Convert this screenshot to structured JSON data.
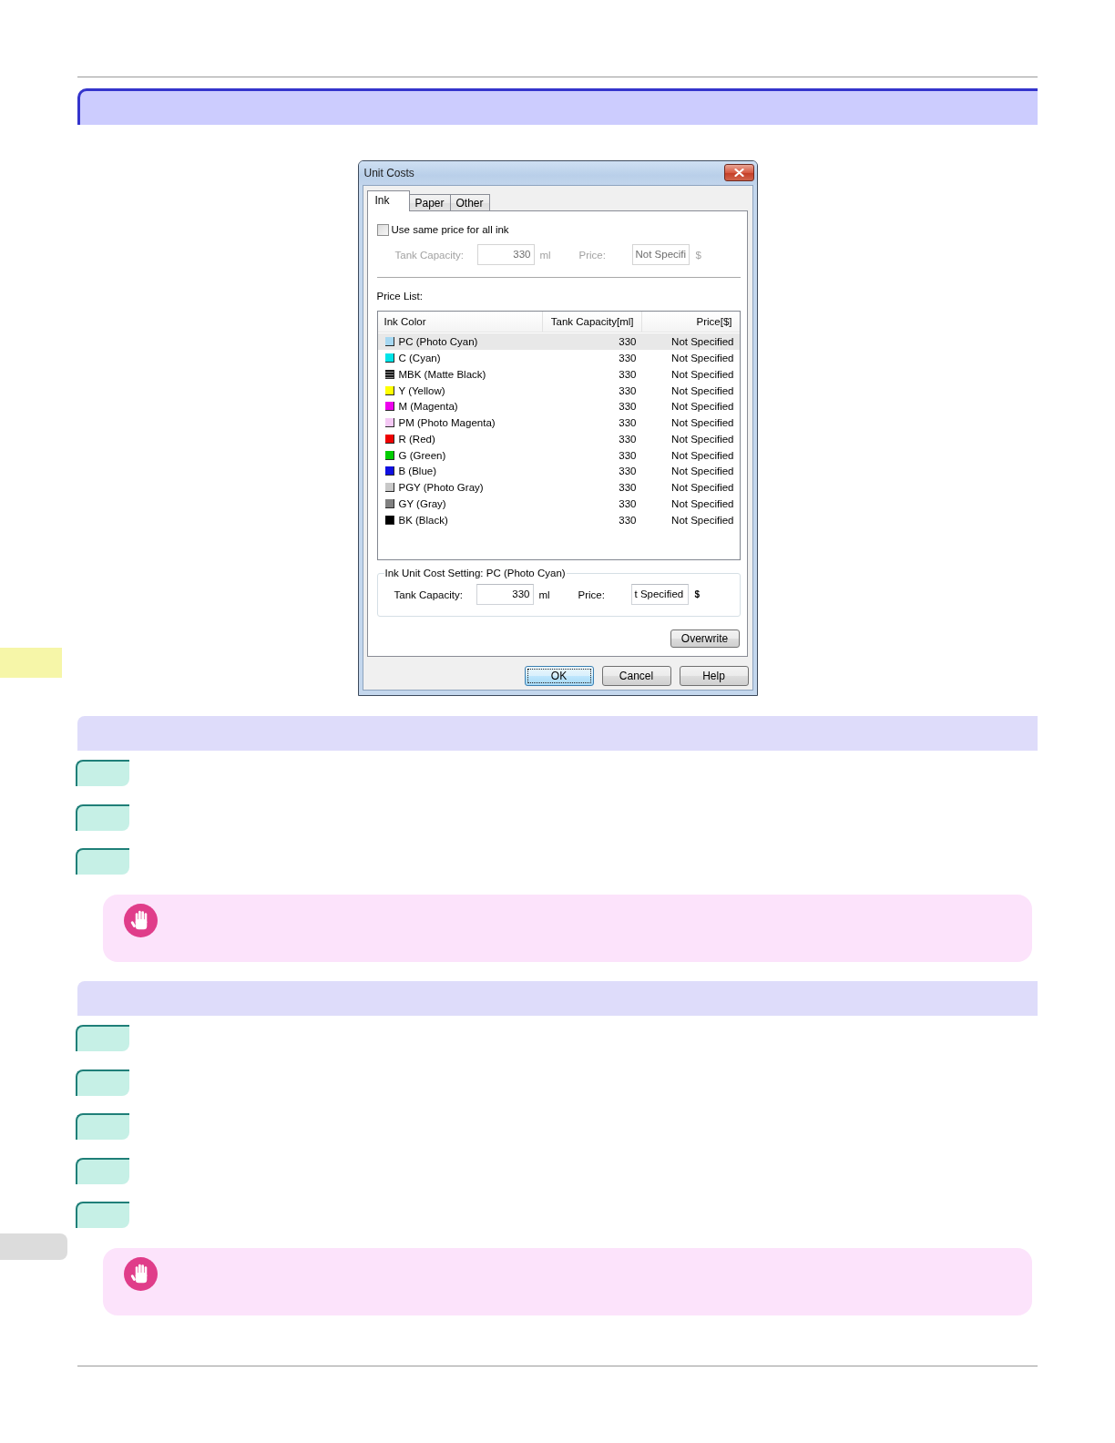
{
  "dialog": {
    "title": "Unit Costs",
    "tabs": [
      {
        "label": "Ink",
        "selected": true
      },
      {
        "label": "Paper",
        "selected": false
      },
      {
        "label": "Other",
        "selected": false
      }
    ],
    "same_price_checkbox": {
      "label": "Use same price for all ink",
      "checked": false
    },
    "shared_price_fields": {
      "disabled": true,
      "capacity_label": "Tank Capacity:",
      "capacity_value": "330",
      "capacity_unit": "ml",
      "price_label": "Price:",
      "price_value": "Not Specifi",
      "price_unit": "$"
    },
    "price_list": {
      "label": "Price List:",
      "columns": [
        "Ink Color",
        "Tank Capacity[ml]",
        "Price[$]"
      ],
      "rows": [
        {
          "name": "PC (Photo Cyan)",
          "color": "#a6d8f2",
          "kind": "solid",
          "capacity": "330",
          "price": "Not Specified",
          "selected": true
        },
        {
          "name": "C (Cyan)",
          "color": "#00e4e8",
          "kind": "solid",
          "capacity": "330",
          "price": "Not Specified",
          "selected": false
        },
        {
          "name": "MBK (Matte Black)",
          "color": "#1a1a1a",
          "kind": "striped",
          "capacity": "330",
          "price": "Not Specified",
          "selected": false
        },
        {
          "name": "Y (Yellow)",
          "color": "#ffff00",
          "kind": "solid",
          "capacity": "330",
          "price": "Not Specified",
          "selected": false
        },
        {
          "name": "M (Magenta)",
          "color": "#ee00ee",
          "kind": "solid",
          "capacity": "330",
          "price": "Not Specified",
          "selected": false
        },
        {
          "name": "PM (Photo Magenta)",
          "color": "#f4c8f4",
          "kind": "solid",
          "capacity": "330",
          "price": "Not Specified",
          "selected": false
        },
        {
          "name": "R (Red)",
          "color": "#ee0000",
          "kind": "solid",
          "capacity": "330",
          "price": "Not Specified",
          "selected": false
        },
        {
          "name": "G (Green)",
          "color": "#00cc00",
          "kind": "solid",
          "capacity": "330",
          "price": "Not Specified",
          "selected": false
        },
        {
          "name": "B (Blue)",
          "color": "#1010e0",
          "kind": "solid",
          "capacity": "330",
          "price": "Not Specified",
          "selected": false
        },
        {
          "name": "PGY (Photo Gray)",
          "color": "#c8c8c8",
          "kind": "solid",
          "capacity": "330",
          "price": "Not Specified",
          "selected": false
        },
        {
          "name": "GY (Gray)",
          "color": "#808080",
          "kind": "solid",
          "capacity": "330",
          "price": "Not Specified",
          "selected": false
        },
        {
          "name": "BK (Black)",
          "color": "#000000",
          "kind": "solid",
          "capacity": "330",
          "price": "Not Specified",
          "selected": false
        }
      ]
    },
    "unit_cost_setting": {
      "title": "Ink Unit Cost Setting: PC (Photo Cyan)",
      "fields": {
        "disabled": false,
        "capacity_label": "Tank Capacity:",
        "capacity_value": "330",
        "capacity_unit": "ml",
        "price_label": "Price:",
        "price_value": "t Specified",
        "price_unit": "$"
      }
    },
    "overwrite_button": {
      "label": "Overwrite"
    },
    "buttons": [
      {
        "label": "OK",
        "default": true
      },
      {
        "label": "Cancel",
        "default": false
      },
      {
        "label": "Help",
        "default": false
      }
    ]
  }
}
